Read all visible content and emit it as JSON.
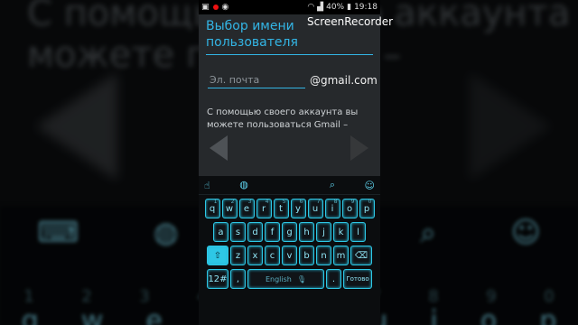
{
  "statusbar": {
    "battery": "40%",
    "time": "19:18"
  },
  "recorder_label": "ScreenRecorder",
  "dialog": {
    "title": "Выбор имени пользователя",
    "email_placeholder": "Эл. почта",
    "email_value": "",
    "domain": "@gmail.com",
    "info_text": "С помощью своего аккаунта вы можете пользоваться Gmail –"
  },
  "keyboard": {
    "row1": [
      {
        "k": "q",
        "n": "1"
      },
      {
        "k": "w",
        "n": "2"
      },
      {
        "k": "e",
        "n": "3"
      },
      {
        "k": "r",
        "n": "4"
      },
      {
        "k": "t",
        "n": "5"
      },
      {
        "k": "y",
        "n": "6"
      },
      {
        "k": "u",
        "n": "7"
      },
      {
        "k": "i",
        "n": "8"
      },
      {
        "k": "o",
        "n": "9"
      },
      {
        "k": "p",
        "n": "0"
      }
    ],
    "row2": [
      "a",
      "s",
      "d",
      "f",
      "g",
      "h",
      "j",
      "k",
      "l"
    ],
    "row3": [
      "z",
      "x",
      "c",
      "v",
      "b",
      "n",
      "m"
    ],
    "numbers_key": "12#",
    "comma_key": ",",
    "space_label": "English",
    "period_key": ".",
    "done_key": "Готово"
  },
  "background": {
    "blur_text_line1": "С помощью своего аккаунта вы",
    "blur_text_line2": "можете пол                Gmail –"
  },
  "colors": {
    "accent": "#33b5e5",
    "key_glow": "#2ec8e6",
    "recording": "#e11111"
  }
}
